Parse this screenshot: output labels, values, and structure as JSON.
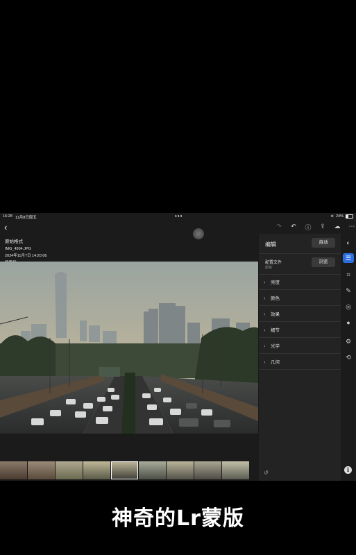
{
  "status_bar": {
    "time": "16:28",
    "date": "11月8日周五",
    "battery": "24%"
  },
  "photo_info": {
    "heading": "原始格式",
    "filename": "IMG_4994.JPG",
    "datetime": "2024年11月7日 14:20:06",
    "version": "原版权"
  },
  "panel": {
    "title": "编辑",
    "auto_label": "自动",
    "profile_label": "配置文件",
    "profile_value": "颜色",
    "browse_label": "浏览",
    "sections": [
      "亮度",
      "颜色",
      "效果",
      "细节",
      "光学",
      "几何"
    ]
  },
  "caption": "神奇的Lr蒙版",
  "icons": {
    "back": "back-icon",
    "redo": "redo-icon",
    "undo": "undo-icon",
    "help": "help-icon",
    "share": "share-icon",
    "sync": "cloud-sync-icon",
    "more": "more-icon"
  },
  "colors": {
    "accent": "#2d6fe0",
    "panel_bg": "#232323"
  }
}
